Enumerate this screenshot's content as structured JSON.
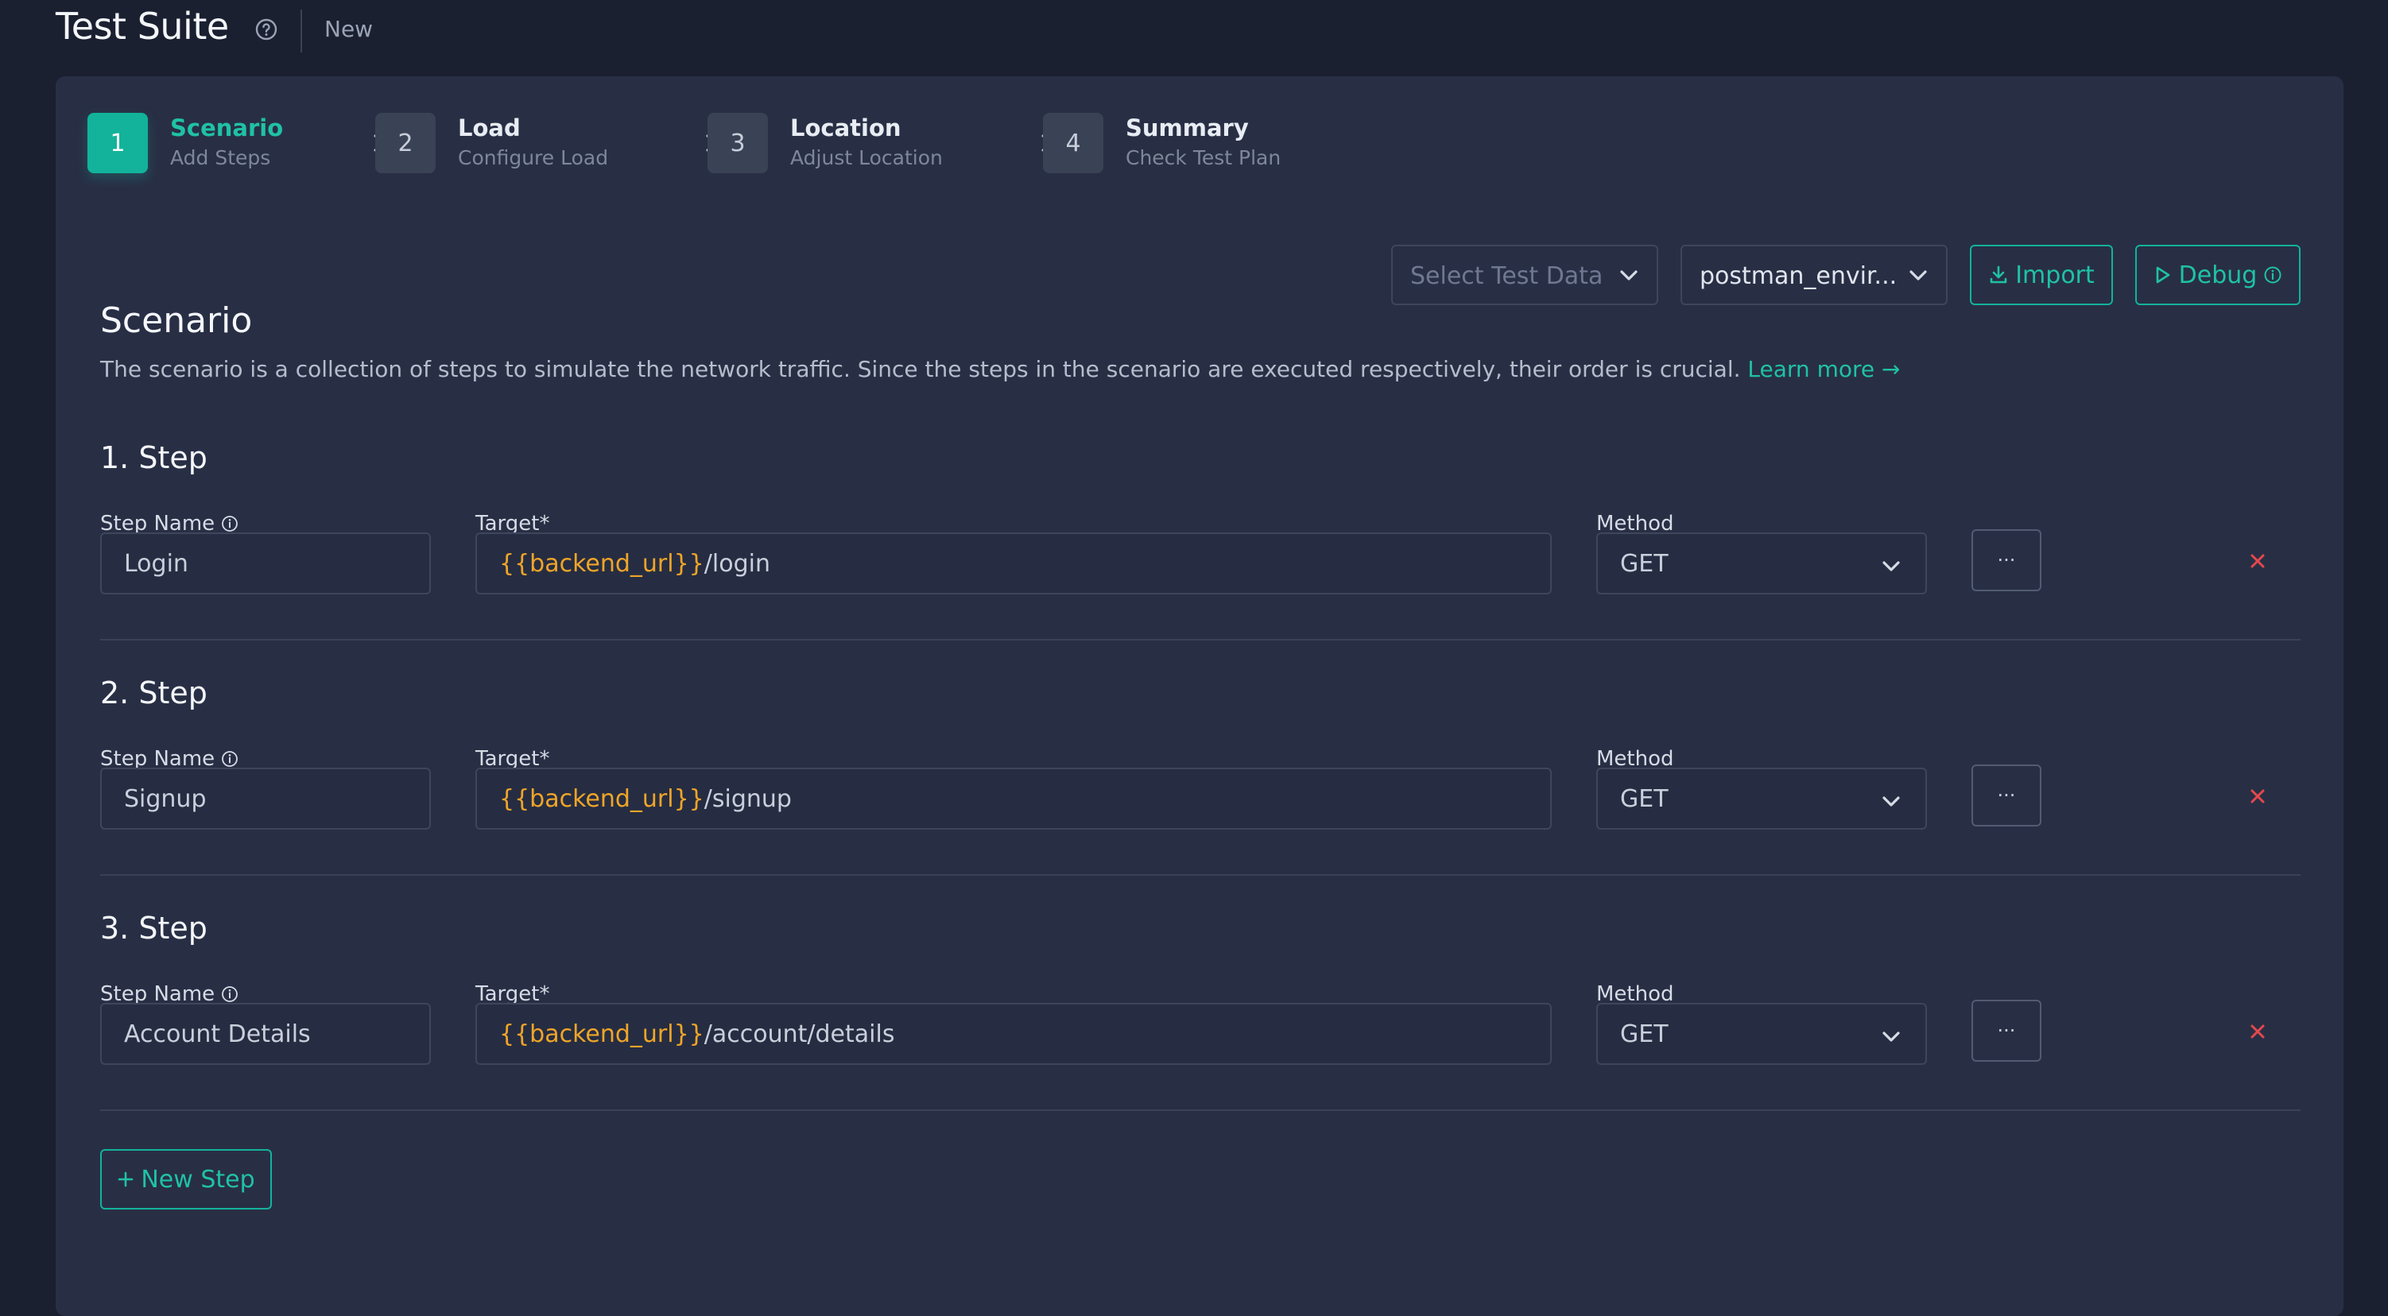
{
  "header": {
    "title": "Test Suite",
    "status": "New"
  },
  "wizard": [
    {
      "num": "1",
      "label": "Scenario",
      "sub": "Add Steps"
    },
    {
      "num": "2",
      "label": "Load",
      "sub": "Configure Load"
    },
    {
      "num": "3",
      "label": "Location",
      "sub": "Adjust Location"
    },
    {
      "num": "4",
      "label": "Summary",
      "sub": "Check Test Plan"
    }
  ],
  "toolbar": {
    "test_data_placeholder": "Select Test Data",
    "environment_value": "postman_envir...",
    "import_label": "Import",
    "debug_label": "Debug"
  },
  "scenario": {
    "title": "Scenario",
    "description": "The scenario is a collection of steps to simulate the network traffic. Since the steps in the scenario are executed respectively, their order is crucial.",
    "learn_more": "Learn more →"
  },
  "labels": {
    "step_name": "Step Name",
    "target": "Target*",
    "method": "Method",
    "more": "···"
  },
  "steps": [
    {
      "heading": "1. Step",
      "name": "Login",
      "target_var": "{{backend_url}}",
      "target_path": "/login",
      "method": "GET"
    },
    {
      "heading": "2. Step",
      "name": "Signup",
      "target_var": "{{backend_url}}",
      "target_path": "/signup",
      "method": "GET"
    },
    {
      "heading": "3. Step",
      "name": "Account Details",
      "target_var": "{{backend_url}}",
      "target_path": "/account/details",
      "method": "GET"
    }
  ],
  "new_step_label": "New Step",
  "colors": {
    "accent": "#12b39a",
    "variable": "#f0a528",
    "danger": "#e5484d",
    "background": "#1a2030",
    "card": "#282f45"
  }
}
